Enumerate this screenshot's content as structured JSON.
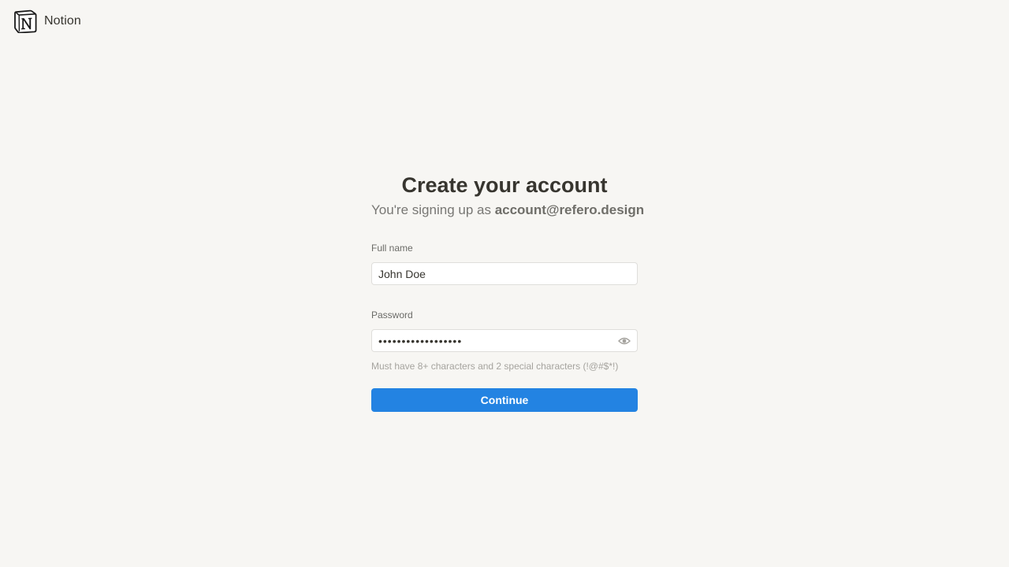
{
  "header": {
    "brand": "Notion",
    "logo_icon": "notion-logo-icon"
  },
  "main": {
    "title": "Create your account",
    "subtitle_prefix": "You're signing up as ",
    "email": "account@refero.design"
  },
  "form": {
    "full_name": {
      "label": "Full name",
      "value": "John Doe"
    },
    "password": {
      "label": "Password",
      "value": "••••••••••••••••••",
      "toggle_icon": "eye-icon",
      "hint": "Must have 8+ characters and 2 special characters (!@#$*!)"
    },
    "submit_label": "Continue"
  },
  "colors": {
    "background": "#f7f6f3",
    "text": "#37352f",
    "muted": "#787774",
    "accent": "#2383e2",
    "input_bg": "#ffffff",
    "input_border": "#dfdedb"
  }
}
